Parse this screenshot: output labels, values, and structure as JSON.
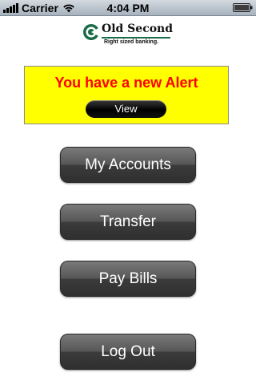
{
  "status_bar": {
    "carrier": "Carrier",
    "time": "4:04 PM",
    "icons": [
      "signal-icon",
      "wifi-icon",
      "battery-icon"
    ]
  },
  "logo": {
    "name": "Old Second",
    "tagline": "Right sized banking.",
    "brand_color": "#1b6b48"
  },
  "alert": {
    "message": "You have a new Alert",
    "view_label": "View",
    "background_color": "#ffff00",
    "text_color": "#ff0000"
  },
  "menu": {
    "my_accounts": "My Accounts",
    "transfer": "Transfer",
    "pay_bills": "Pay Bills",
    "log_out": "Log Out"
  }
}
